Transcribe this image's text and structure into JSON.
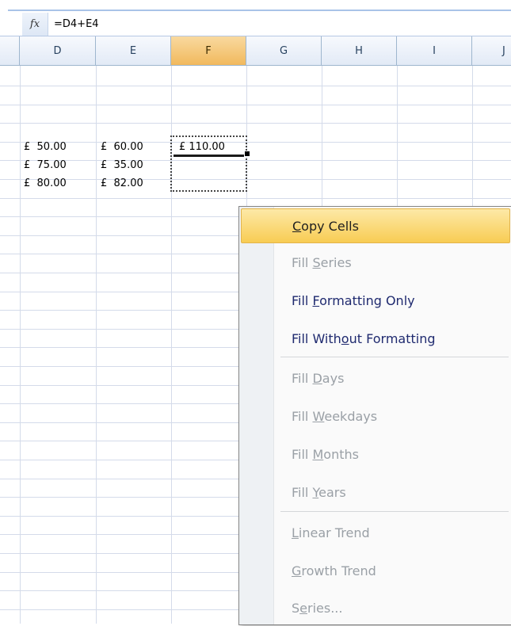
{
  "formula_bar": {
    "fx_label": "fx",
    "formula": "=D4+E4"
  },
  "columns": [
    {
      "label": "D"
    },
    {
      "label": "E"
    },
    {
      "label": "F",
      "active": true
    },
    {
      "label": "G"
    },
    {
      "label": "H"
    },
    {
      "label": "I"
    },
    {
      "label": "J"
    }
  ],
  "cells": {
    "d4": "£  50.00",
    "e4": "£  60.00",
    "f4": "£ 110.00",
    "d5": "£  75.00",
    "e5": "£  35.00",
    "d6": "£  80.00",
    "e6": "£  82.00"
  },
  "context_menu": {
    "items": [
      {
        "pre": "",
        "u": "C",
        "post": "opy Cells",
        "enabled": true,
        "highlighted": true
      },
      {
        "pre": "Fill ",
        "u": "S",
        "post": "eries",
        "enabled": false
      },
      {
        "pre": "Fill ",
        "u": "F",
        "post": "ormatting Only",
        "enabled": true
      },
      {
        "pre": "Fill With",
        "u": "o",
        "post": "ut Formatting",
        "enabled": true
      },
      {
        "pre": "Fill ",
        "u": "D",
        "post": "ays",
        "enabled": false
      },
      {
        "pre": "Fill ",
        "u": "W",
        "post": "eekdays",
        "enabled": false
      },
      {
        "pre": "Fill ",
        "u": "M",
        "post": "onths",
        "enabled": false
      },
      {
        "pre": "Fill ",
        "u": "Y",
        "post": "ears",
        "enabled": false
      },
      {
        "pre": "",
        "u": "L",
        "post": "inear Trend",
        "enabled": false
      },
      {
        "pre": "",
        "u": "G",
        "post": "rowth Trend",
        "enabled": false
      },
      {
        "pre": "S",
        "u": "e",
        "post": "ries...",
        "enabled": false
      }
    ]
  },
  "colors": {
    "active_header": "#f1b95d",
    "menu_highlight": "#f8cc53",
    "menu_text": "#1f2a6f",
    "disabled_text": "#9aa0a6"
  }
}
